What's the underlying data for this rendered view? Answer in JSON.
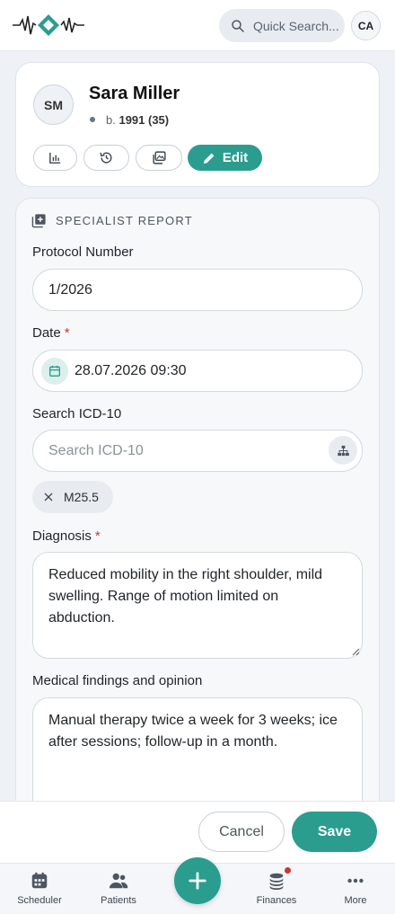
{
  "header": {
    "search_placeholder": "Quick Search...",
    "user_initials": "CA"
  },
  "patient": {
    "initials": "SM",
    "name": "Sara Miller",
    "birth_prefix": "b.",
    "birth_value": "1991 (35)",
    "edit_label": "Edit"
  },
  "report": {
    "section_title": "SPECIALIST REPORT",
    "protocol_label": "Protocol Number",
    "protocol_value": "1/2026",
    "date_label": "Date",
    "date_value": "28.07.2026 09:30",
    "icd_label": "Search ICD-10",
    "icd_placeholder": "Search ICD-10",
    "icd_chip": "M25.5",
    "diagnosis_label": "Diagnosis",
    "diagnosis_text": "Reduced mobility in the right shoulder, mild swelling. Range of motion limited on abduction.",
    "findings_label": "Medical findings and opinion",
    "findings_text": "Manual therapy twice a week for 3 weeks; ice after sessions; follow-up in a month.",
    "required_mark": "*"
  },
  "actions": {
    "cancel_label": "Cancel",
    "save_label": "Save"
  },
  "nav": {
    "items": [
      {
        "label": "Scheduler",
        "icon": "calendar-icon"
      },
      {
        "label": "Patients",
        "icon": "users-icon"
      },
      {
        "label": "Finances",
        "icon": "coins-icon"
      },
      {
        "label": "More",
        "icon": "more-icon"
      }
    ]
  },
  "colors": {
    "accent": "#2a9d8f",
    "required": "#d0342c"
  }
}
